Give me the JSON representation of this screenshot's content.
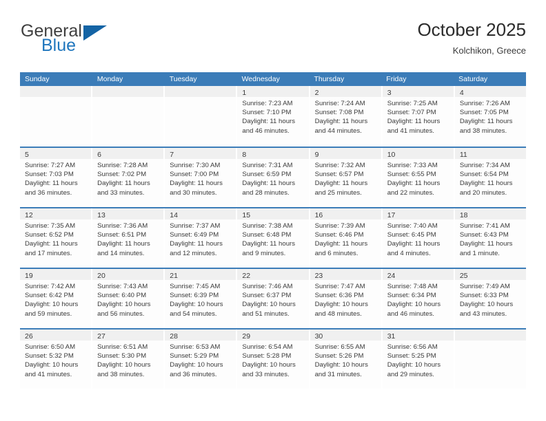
{
  "brand": {
    "name_primary": "General",
    "name_secondary": "Blue",
    "triangle_icon": "triangle-icon",
    "accent_color": "#1464a5"
  },
  "header": {
    "title": "October 2025",
    "subtitle": "Kolchikon, Greece"
  },
  "theme": {
    "header_band": "#3b7cb8",
    "daynum_strip": "#f0f0f0",
    "text": "#3a3a3a"
  },
  "calendar": {
    "weekdays": [
      "Sunday",
      "Monday",
      "Tuesday",
      "Wednesday",
      "Thursday",
      "Friday",
      "Saturday"
    ],
    "weeks": [
      [
        {
          "day": "",
          "empty": true
        },
        {
          "day": "",
          "empty": true
        },
        {
          "day": "",
          "empty": true
        },
        {
          "day": "1",
          "sunrise": "Sunrise: 7:23 AM",
          "sunset": "Sunset: 7:10 PM",
          "daylight": "Daylight: 11 hours and 46 minutes."
        },
        {
          "day": "2",
          "sunrise": "Sunrise: 7:24 AM",
          "sunset": "Sunset: 7:08 PM",
          "daylight": "Daylight: 11 hours and 44 minutes."
        },
        {
          "day": "3",
          "sunrise": "Sunrise: 7:25 AM",
          "sunset": "Sunset: 7:07 PM",
          "daylight": "Daylight: 11 hours and 41 minutes."
        },
        {
          "day": "4",
          "sunrise": "Sunrise: 7:26 AM",
          "sunset": "Sunset: 7:05 PM",
          "daylight": "Daylight: 11 hours and 38 minutes."
        }
      ],
      [
        {
          "day": "5",
          "sunrise": "Sunrise: 7:27 AM",
          "sunset": "Sunset: 7:03 PM",
          "daylight": "Daylight: 11 hours and 36 minutes."
        },
        {
          "day": "6",
          "sunrise": "Sunrise: 7:28 AM",
          "sunset": "Sunset: 7:02 PM",
          "daylight": "Daylight: 11 hours and 33 minutes."
        },
        {
          "day": "7",
          "sunrise": "Sunrise: 7:30 AM",
          "sunset": "Sunset: 7:00 PM",
          "daylight": "Daylight: 11 hours and 30 minutes."
        },
        {
          "day": "8",
          "sunrise": "Sunrise: 7:31 AM",
          "sunset": "Sunset: 6:59 PM",
          "daylight": "Daylight: 11 hours and 28 minutes."
        },
        {
          "day": "9",
          "sunrise": "Sunrise: 7:32 AM",
          "sunset": "Sunset: 6:57 PM",
          "daylight": "Daylight: 11 hours and 25 minutes."
        },
        {
          "day": "10",
          "sunrise": "Sunrise: 7:33 AM",
          "sunset": "Sunset: 6:55 PM",
          "daylight": "Daylight: 11 hours and 22 minutes."
        },
        {
          "day": "11",
          "sunrise": "Sunrise: 7:34 AM",
          "sunset": "Sunset: 6:54 PM",
          "daylight": "Daylight: 11 hours and 20 minutes."
        }
      ],
      [
        {
          "day": "12",
          "sunrise": "Sunrise: 7:35 AM",
          "sunset": "Sunset: 6:52 PM",
          "daylight": "Daylight: 11 hours and 17 minutes."
        },
        {
          "day": "13",
          "sunrise": "Sunrise: 7:36 AM",
          "sunset": "Sunset: 6:51 PM",
          "daylight": "Daylight: 11 hours and 14 minutes."
        },
        {
          "day": "14",
          "sunrise": "Sunrise: 7:37 AM",
          "sunset": "Sunset: 6:49 PM",
          "daylight": "Daylight: 11 hours and 12 minutes."
        },
        {
          "day": "15",
          "sunrise": "Sunrise: 7:38 AM",
          "sunset": "Sunset: 6:48 PM",
          "daylight": "Daylight: 11 hours and 9 minutes."
        },
        {
          "day": "16",
          "sunrise": "Sunrise: 7:39 AM",
          "sunset": "Sunset: 6:46 PM",
          "daylight": "Daylight: 11 hours and 6 minutes."
        },
        {
          "day": "17",
          "sunrise": "Sunrise: 7:40 AM",
          "sunset": "Sunset: 6:45 PM",
          "daylight": "Daylight: 11 hours and 4 minutes."
        },
        {
          "day": "18",
          "sunrise": "Sunrise: 7:41 AM",
          "sunset": "Sunset: 6:43 PM",
          "daylight": "Daylight: 11 hours and 1 minute."
        }
      ],
      [
        {
          "day": "19",
          "sunrise": "Sunrise: 7:42 AM",
          "sunset": "Sunset: 6:42 PM",
          "daylight": "Daylight: 10 hours and 59 minutes."
        },
        {
          "day": "20",
          "sunrise": "Sunrise: 7:43 AM",
          "sunset": "Sunset: 6:40 PM",
          "daylight": "Daylight: 10 hours and 56 minutes."
        },
        {
          "day": "21",
          "sunrise": "Sunrise: 7:45 AM",
          "sunset": "Sunset: 6:39 PM",
          "daylight": "Daylight: 10 hours and 54 minutes."
        },
        {
          "day": "22",
          "sunrise": "Sunrise: 7:46 AM",
          "sunset": "Sunset: 6:37 PM",
          "daylight": "Daylight: 10 hours and 51 minutes."
        },
        {
          "day": "23",
          "sunrise": "Sunrise: 7:47 AM",
          "sunset": "Sunset: 6:36 PM",
          "daylight": "Daylight: 10 hours and 48 minutes."
        },
        {
          "day": "24",
          "sunrise": "Sunrise: 7:48 AM",
          "sunset": "Sunset: 6:34 PM",
          "daylight": "Daylight: 10 hours and 46 minutes."
        },
        {
          "day": "25",
          "sunrise": "Sunrise: 7:49 AM",
          "sunset": "Sunset: 6:33 PM",
          "daylight": "Daylight: 10 hours and 43 minutes."
        }
      ],
      [
        {
          "day": "26",
          "sunrise": "Sunrise: 6:50 AM",
          "sunset": "Sunset: 5:32 PM",
          "daylight": "Daylight: 10 hours and 41 minutes."
        },
        {
          "day": "27",
          "sunrise": "Sunrise: 6:51 AM",
          "sunset": "Sunset: 5:30 PM",
          "daylight": "Daylight: 10 hours and 38 minutes."
        },
        {
          "day": "28",
          "sunrise": "Sunrise: 6:53 AM",
          "sunset": "Sunset: 5:29 PM",
          "daylight": "Daylight: 10 hours and 36 minutes."
        },
        {
          "day": "29",
          "sunrise": "Sunrise: 6:54 AM",
          "sunset": "Sunset: 5:28 PM",
          "daylight": "Daylight: 10 hours and 33 minutes."
        },
        {
          "day": "30",
          "sunrise": "Sunrise: 6:55 AM",
          "sunset": "Sunset: 5:26 PM",
          "daylight": "Daylight: 10 hours and 31 minutes."
        },
        {
          "day": "31",
          "sunrise": "Sunrise: 6:56 AM",
          "sunset": "Sunset: 5:25 PM",
          "daylight": "Daylight: 10 hours and 29 minutes."
        },
        {
          "day": "",
          "empty": true
        }
      ]
    ]
  }
}
